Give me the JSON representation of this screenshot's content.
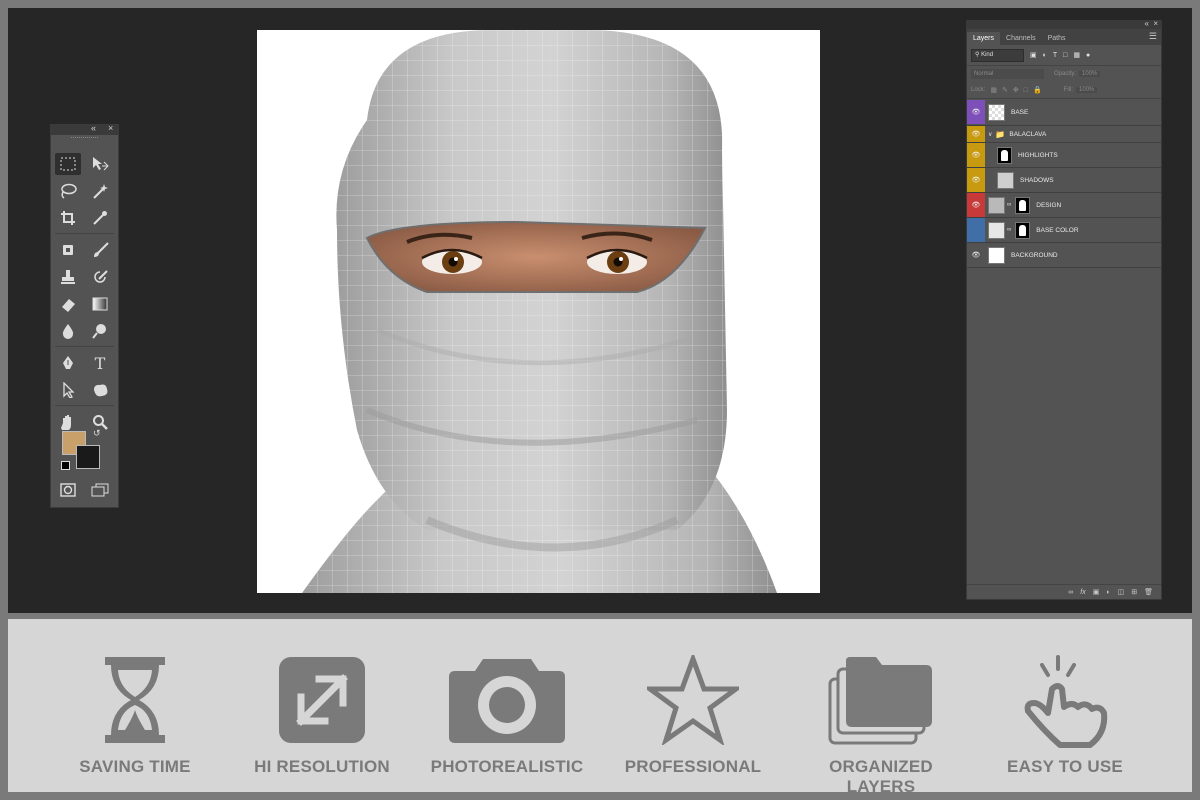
{
  "layers_panel": {
    "tabs": [
      "Layers",
      "Channels",
      "Paths"
    ],
    "filter_kind": "Kind",
    "blend_mode": "Normal",
    "opacity_label": "Opacity:",
    "opacity_value": "100%",
    "lock_label": "Lock:",
    "fill_label": "Fill:",
    "fill_value": "100%",
    "layers": [
      {
        "name": "BASE",
        "color": "#7d4fb8"
      },
      {
        "name": "BALACLAVA",
        "color": "#c79a10"
      },
      {
        "name": "HIGHLIGHTS",
        "color": "#c79a10"
      },
      {
        "name": "SHADOWS",
        "color": "#c79a10"
      },
      {
        "name": "DESIGN",
        "color": "#c83a3a"
      },
      {
        "name": "BASE COLOR",
        "color": "#3f6fa6"
      },
      {
        "name": "BACKGROUND",
        "color": "#535353"
      }
    ],
    "footer_icons": [
      "link-icon",
      "fx-icon",
      "mask-icon",
      "adjustment-icon",
      "folder-icon",
      "new-layer-icon",
      "trash-icon"
    ]
  },
  "toolbar": {
    "foreground_color": "#c9a06a",
    "background_color": "#1a1a1a"
  },
  "features": [
    {
      "label": "SAVING TIME",
      "icon": "hourglass-icon"
    },
    {
      "label": "HI RESOLUTION",
      "icon": "expand-icon"
    },
    {
      "label": "PHOTOREALISTIC",
      "icon": "camera-icon"
    },
    {
      "label": "PROFESSIONAL",
      "icon": "star-icon"
    },
    {
      "label": "ORGANIZED LAYERS",
      "icon": "layers-folder-icon"
    },
    {
      "label": "EASY TO USE",
      "icon": "tap-hand-icon"
    }
  ]
}
